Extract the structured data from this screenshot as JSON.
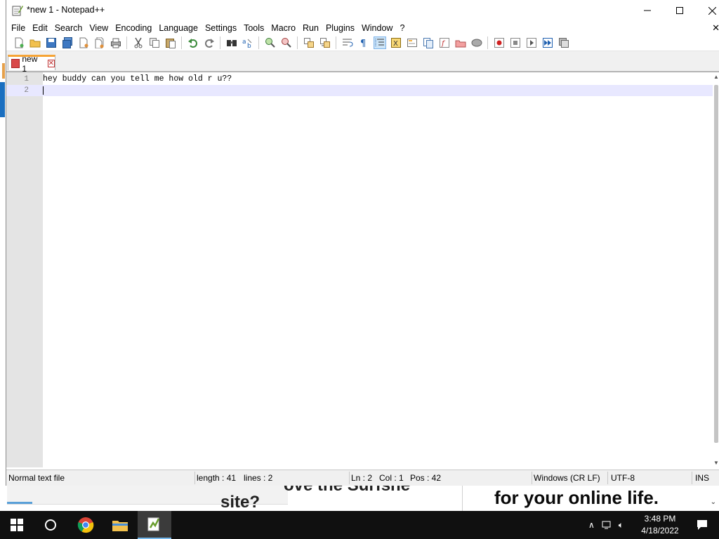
{
  "window": {
    "title": "*new 1 - Notepad++",
    "controls": {
      "minimize": "—",
      "maximize": "☐",
      "close": "✕"
    }
  },
  "menu": {
    "items": [
      "File",
      "Edit",
      "Search",
      "View",
      "Encoding",
      "Language",
      "Settings",
      "Tools",
      "Macro",
      "Run",
      "Plugins",
      "Window",
      "?"
    ],
    "close_doc": "✕"
  },
  "toolbar": {
    "icons": [
      "new-file-icon",
      "open-file-icon",
      "save-icon",
      "save-all-icon",
      "close-icon",
      "close-all-icon",
      "print-icon",
      "cut-icon",
      "copy-icon",
      "paste-icon",
      "undo-icon",
      "redo-icon",
      "find-icon",
      "replace-icon",
      "zoom-in-icon",
      "zoom-out-icon",
      "sync-vertical-icon",
      "sync-horizontal-icon",
      "word-wrap-icon",
      "show-all-chars-icon",
      "indent-guide-icon",
      "udl-icon",
      "doc-map-icon",
      "doc-list-icon",
      "function-list-icon",
      "folder-workspace-icon",
      "monitoring-icon",
      "record-macro-icon",
      "stop-macro-icon",
      "play-macro-icon",
      "run-macro-multiple-icon",
      "save-macro-icon"
    ]
  },
  "tabs": [
    {
      "label": "new 1",
      "close": "✕"
    }
  ],
  "editor": {
    "lines": [
      {
        "number": "1",
        "text": "hey buddy can you tell me how old r u??"
      },
      {
        "number": "2",
        "text": ""
      }
    ],
    "current_line": 2
  },
  "statusbar": {
    "file_type": "Normal text file",
    "length": "length : 41",
    "lines": "lines : 2",
    "ln": "Ln : 2",
    "col": "Col : 1",
    "pos": "Pos : 42",
    "eol": "Windows (CR LF)",
    "encoding": "UTF-8",
    "mode": "INS"
  },
  "background": {
    "partial_text_1": "ove the Surfshe",
    "partial_text_2": "site?",
    "partial_text_3": "for your online life."
  },
  "taskbar": {
    "apps": [
      "start-icon",
      "search-icon",
      "chrome-icon",
      "file-explorer-icon",
      "notepadpp-icon"
    ],
    "time": "3:48 PM",
    "date": "4/18/2022"
  },
  "colors": {
    "tab_accent": "#f6a435",
    "current_line": "#e8e8ff",
    "gutter": "#e4e4e4",
    "taskbar": "#101010"
  }
}
